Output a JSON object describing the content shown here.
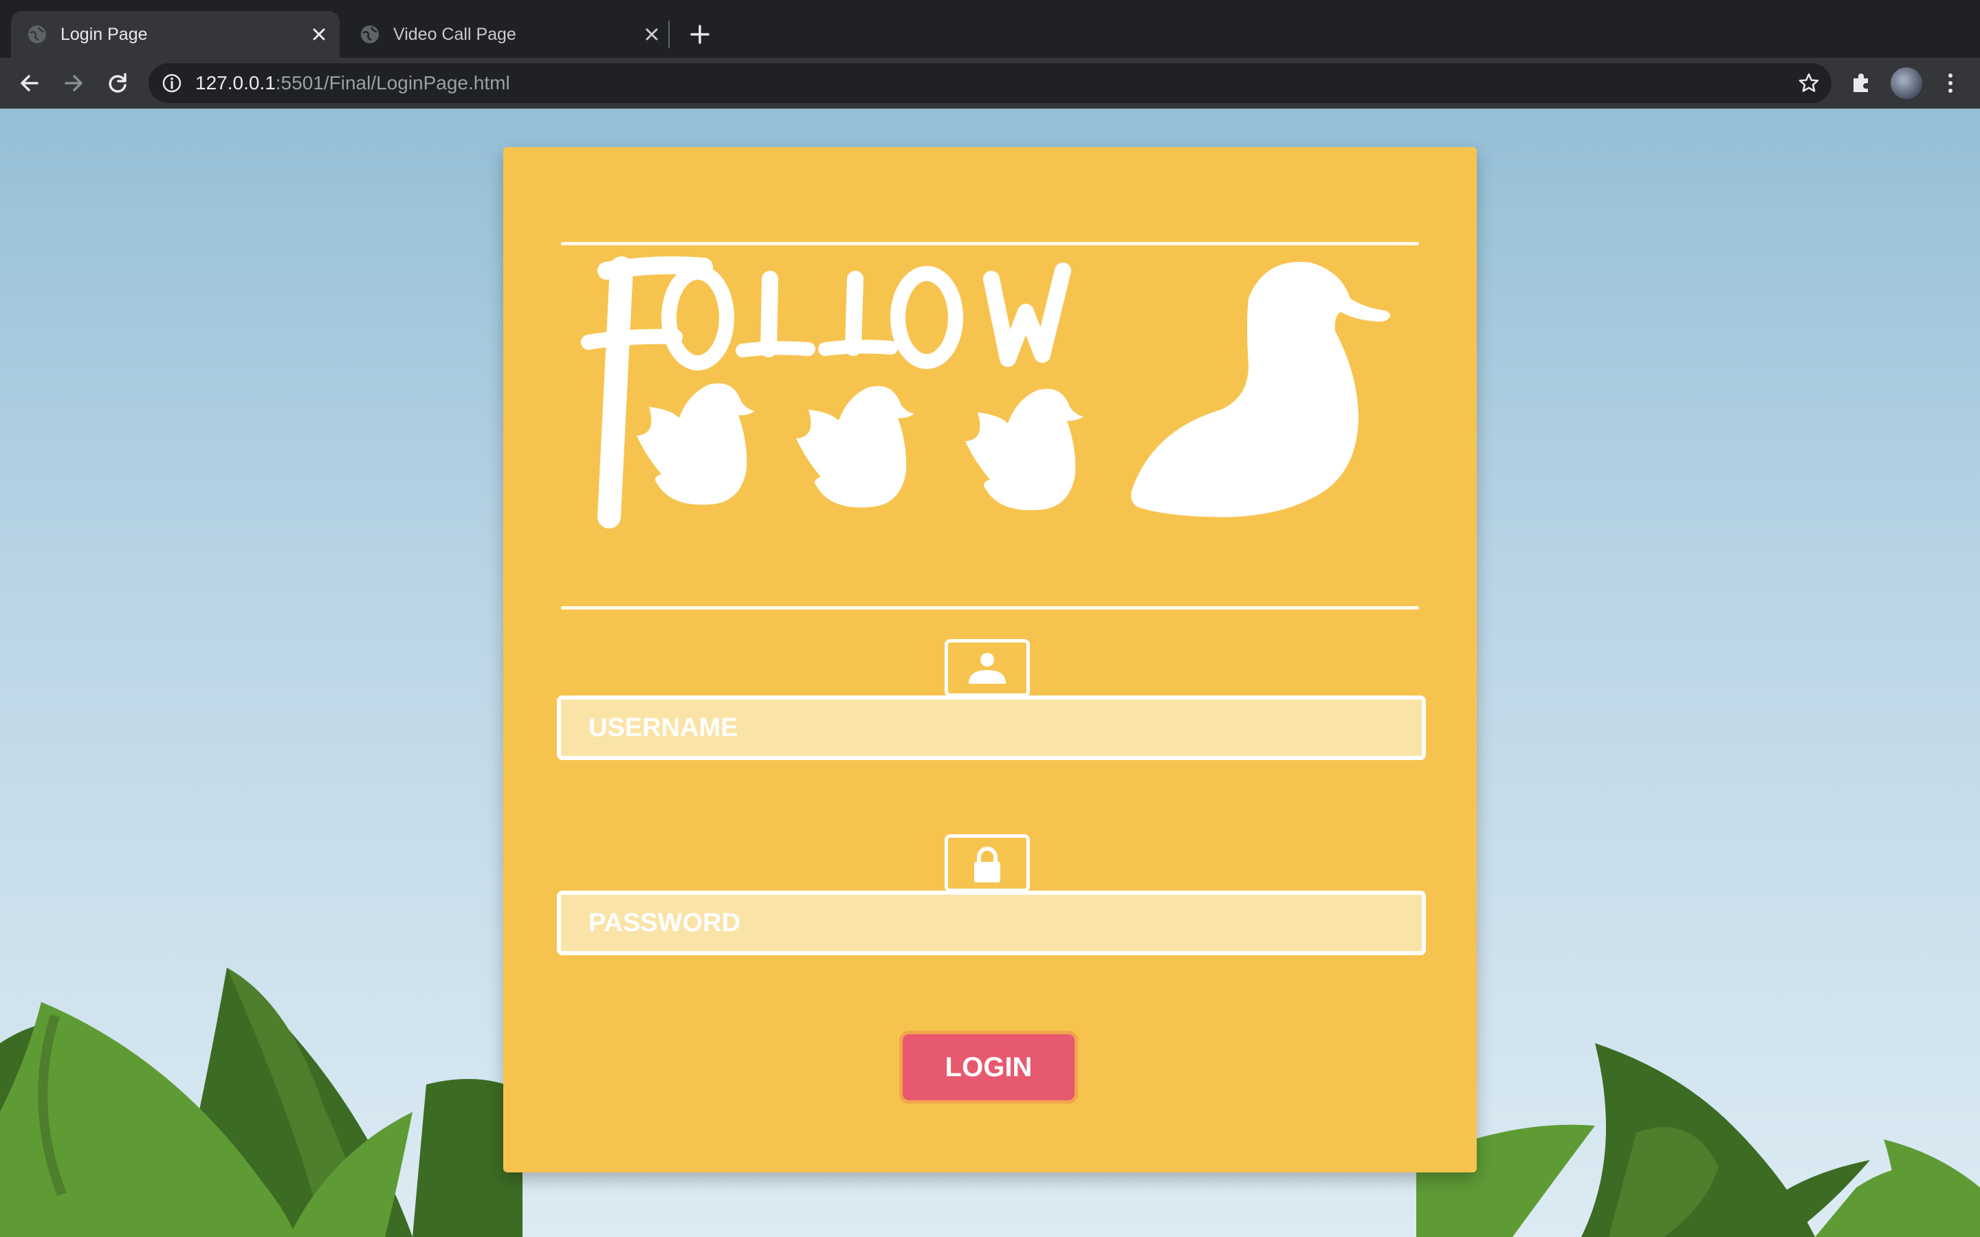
{
  "browser": {
    "tabs": [
      {
        "title": "Login Page",
        "active": true,
        "icon": "globe-icon"
      },
      {
        "title": "Video Call Page",
        "active": false,
        "icon": "globe-icon"
      }
    ],
    "url": {
      "host": "127.0.0.1",
      "rest": ":5501/Final/LoginPage.html"
    }
  },
  "login": {
    "logo_text": "FOLLOW",
    "username_placeholder": "USERNAME",
    "password_placeholder": "PASSWORD",
    "login_label": "LOGIN"
  },
  "colors": {
    "card": "#f7c34f",
    "field_bg": "#fae3a6",
    "button": "#e6596f",
    "leaf_dark": "#3c6b24",
    "leaf_light": "#5e9b35",
    "sky_top": "#94bfd7",
    "sky_bottom": "#dcebf3"
  }
}
